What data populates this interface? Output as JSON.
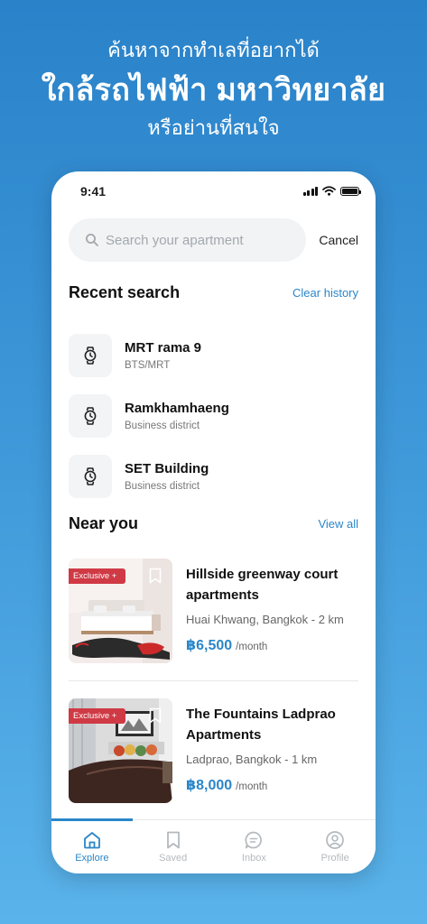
{
  "hero": {
    "line1": "ค้นหาจากทำเลที่อยากได้",
    "line2": "ใกล้รถไฟฟ้า มหาวิทยาลัย",
    "line3": "หรือย่านที่สนใจ"
  },
  "status_bar": {
    "time": "9:41"
  },
  "search": {
    "placeholder": "Search your apartment",
    "value": "",
    "cancel_label": "Cancel"
  },
  "recent_search": {
    "title": "Recent search",
    "clear_label": "Clear history",
    "items": [
      {
        "title": "MRT rama 9",
        "subtitle": "BTS/MRT",
        "icon": "watch-icon"
      },
      {
        "title": "Ramkhamhaeng",
        "subtitle": "Business district",
        "icon": "watch-icon"
      },
      {
        "title": "SET Building",
        "subtitle": "Business district",
        "icon": "watch-icon"
      }
    ]
  },
  "near_you": {
    "title": "Near you",
    "view_all_label": "View all",
    "listings": [
      {
        "badge": "Exclusive +",
        "title_line1": "Hillside greenway court",
        "title_line2": "apartments",
        "location": "Huai Khwang, Bangkok - 2 km",
        "price": "฿6,500",
        "per": "/month"
      },
      {
        "badge": "Exclusive +",
        "title_line1": "The Fountains Ladprao",
        "title_line2": "Apartments",
        "location": "Ladprao, Bangkok - 1 km",
        "price": "฿8,000",
        "per": "/month"
      }
    ]
  },
  "tabs": [
    {
      "label": "Explore",
      "icon": "home-icon",
      "active": true
    },
    {
      "label": "Saved",
      "icon": "bookmark-icon",
      "active": false
    },
    {
      "label": "Inbox",
      "icon": "chat-icon",
      "active": false
    },
    {
      "label": "Profile",
      "icon": "user-icon",
      "active": false
    }
  ],
  "colors": {
    "accent": "#2b86c9",
    "badge": "#cf3a45",
    "background_top": "#2a82c9",
    "background_bottom": "#5ab3ea"
  }
}
